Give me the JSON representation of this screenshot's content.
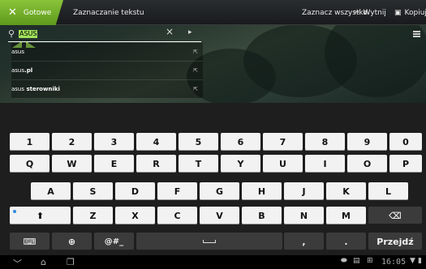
{
  "action_bar": {
    "done_label": "Gotowe",
    "title": "Zaznaczanie tekstu",
    "select_all": "Zaznacz wszystko",
    "cut": "Wytnij",
    "copy": "Kopiuj"
  },
  "search": {
    "value": "ASUS"
  },
  "suggestions": [
    {
      "prefix": "asus",
      "suffix": ""
    },
    {
      "prefix": "asus",
      "suffix": ".pl"
    },
    {
      "prefix": "asus",
      "suffix": " sterowniki"
    }
  ],
  "keyboard": {
    "row_numbers": [
      "1",
      "2",
      "3",
      "4",
      "5",
      "6",
      "7",
      "8",
      "9",
      "0"
    ],
    "row_q": [
      "Q",
      "W",
      "E",
      "R",
      "T",
      "Y",
      "U",
      "I",
      "O",
      "P"
    ],
    "row_a": [
      "A",
      "S",
      "D",
      "F",
      "G",
      "H",
      "J",
      "K",
      "L"
    ],
    "row_z": [
      "Z",
      "X",
      "C",
      "V",
      "B",
      "N",
      "M"
    ],
    "symbols_label": "@#_",
    "comma": ",",
    "period": ".",
    "enter_label": "Przejdź"
  },
  "status": {
    "time": "16:05"
  },
  "colors": {
    "accent": "#8ac43a",
    "selection": "#9fe05a"
  }
}
